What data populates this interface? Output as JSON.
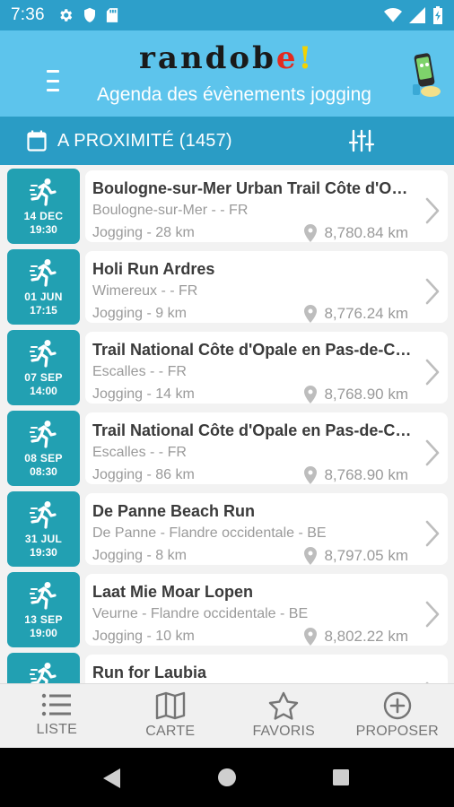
{
  "status": {
    "time": "7:36"
  },
  "header": {
    "logo": {
      "part1": "randob",
      "part2": "e",
      "part3": "!"
    },
    "subtitle": "Agenda des évènements jogging"
  },
  "filter": {
    "label": "A PROXIMITÉ (1457)"
  },
  "events": [
    {
      "day": "14 DEC",
      "time": "19:30",
      "title": "Boulogne-sur-Mer Urban Trail Côte d'Opale",
      "location": "Boulogne-sur-Mer -  - FR",
      "sport": "Jogging - 28 km",
      "distance": "8,780.84 km"
    },
    {
      "day": "01 JUN",
      "time": "17:15",
      "title": "Holi Run Ardres",
      "location": "Wimereux -  - FR",
      "sport": "Jogging - 9 km",
      "distance": "8,776.24 km"
    },
    {
      "day": "07 SEP",
      "time": "14:00",
      "title": "Trail National Côte d'Opale en Pas-de-Calais",
      "location": "Escalles -  - FR",
      "sport": "Jogging - 14 km",
      "distance": "8,768.90 km"
    },
    {
      "day": "08 SEP",
      "time": "08:30",
      "title": "Trail National Côte d'Opale en Pas-de-Calais",
      "location": "Escalles -  - FR",
      "sport": "Jogging - 86 km",
      "distance": "8,768.90 km"
    },
    {
      "day": "31 JUL",
      "time": "19:30",
      "title": "De Panne Beach Run",
      "location": "De Panne - Flandre occidentale - BE",
      "sport": "Jogging - 8 km",
      "distance": "8,797.05 km"
    },
    {
      "day": "13 SEP",
      "time": "19:00",
      "title": "Laat Mie Moar Lopen",
      "location": "Veurne - Flandre occidentale - BE",
      "sport": "Jogging - 10 km",
      "distance": "8,802.22 km"
    },
    {
      "day": "",
      "time": "",
      "title": "Run for Laubia",
      "location": "",
      "sport": "",
      "distance": ""
    }
  ],
  "nav": [
    {
      "label": "LISTE",
      "icon": "list-icon"
    },
    {
      "label": "CARTE",
      "icon": "map-icon"
    },
    {
      "label": "FAVORIS",
      "icon": "star-icon"
    },
    {
      "label": "PROPOSER",
      "icon": "add-circle-icon"
    }
  ],
  "colors": {
    "status": "#2d9fca",
    "header": "#5dc4ec",
    "filter": "#2a9cc5",
    "badge": "#22a0b2"
  }
}
